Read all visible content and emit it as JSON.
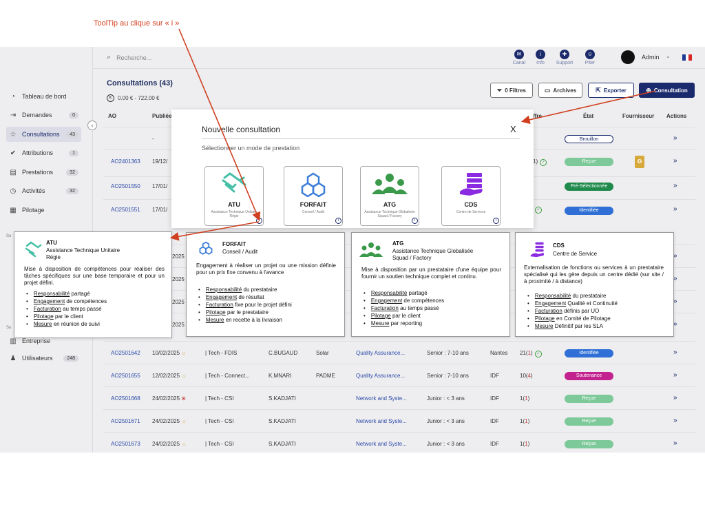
{
  "annotation": "ToolTip au clique sur « i »",
  "search": {
    "placeholder": "Recherche..."
  },
  "tools": [
    {
      "label": "Canal",
      "icon": "chat-icon"
    },
    {
      "label": "Info",
      "icon": "info-icon"
    },
    {
      "label": "Support",
      "icon": "lifebuoy-icon"
    },
    {
      "label": "Piter",
      "icon": "bot-icon"
    }
  ],
  "user": {
    "name": "Admin"
  },
  "flag_colors": [
    "#1f3a93",
    "#ffffff",
    "#d62828"
  ],
  "sidebar": {
    "items": [
      {
        "label": "Tableau de bord",
        "count": ""
      },
      {
        "label": "Demandes",
        "count": "0"
      },
      {
        "label": "Consultations",
        "count": "43"
      },
      {
        "label": "Attributions",
        "count": "1"
      },
      {
        "label": "Prestations",
        "count": "32"
      },
      {
        "label": "Activités",
        "count": "32"
      },
      {
        "label": "Pilotage",
        "count": ""
      }
    ],
    "section1": "So",
    "section2": "So",
    "lower_items": [
      {
        "label": "Entreprise",
        "count": ""
      },
      {
        "label": "Utilisateurs",
        "count": "248"
      }
    ]
  },
  "page": {
    "title": "Consultations (43)",
    "amount": "0.00 € - 722.00 €",
    "currency_symbol": "€"
  },
  "toolbar": {
    "filters": "0 Filtres",
    "archives": "Archives",
    "export": "Exporter",
    "new": "Consultation"
  },
  "table": {
    "headers": {
      "ao": "AO",
      "published": "Publiée",
      "offer": "ffre",
      "state": "État",
      "supplier": "Fournisseur",
      "actions": "Actions"
    },
    "top_rows": [
      {
        "ao": "",
        "date": "-",
        "offer": "",
        "state": "Brouillon"
      },
      {
        "ao": "AO2401363",
        "date": "19/12/",
        "offer": "1)",
        "state": "Reçue"
      },
      {
        "ao": "AO2501550",
        "date": "17/01/",
        "offer": "",
        "state": "Pré-Sélectionnée"
      },
      {
        "ao": "AO2501551",
        "date": "17/01/",
        "offer": "",
        "state": "Identifiée"
      }
    ],
    "hidden_row_dates": [
      "2025",
      "2025",
      "2025",
      "2025"
    ],
    "rows": [
      {
        "ao": "AO2501642",
        "date": "10/02/2025",
        "dept": "| Tech - FDIS",
        "buyer": "C.BUGAUD",
        "client": "Solar",
        "mission": "Quality Assurance...",
        "level": "Senior : 7-10 ans",
        "city": "Nantes",
        "offers": "21",
        "new": "1",
        "state": "Identifiée"
      },
      {
        "ao": "AO2501655",
        "date": "12/02/2025",
        "dept": "| Tech - Connect...",
        "buyer": "K.MNARI",
        "client": "PADME",
        "mission": "Quality Assurance...",
        "level": "Senior : 7-10 ans",
        "city": "IDF",
        "offers": "10",
        "new": "4",
        "state": "Soutenance"
      },
      {
        "ao": "AO2501668",
        "date": "24/02/2025",
        "dept": "| Tech - CSI",
        "buyer": "S.KADJATI",
        "client": "",
        "mission": "Network and Syste...",
        "level": "Junior : < 3 ans",
        "city": "IDF",
        "offers": "1",
        "new": "1",
        "state": "Reçue"
      },
      {
        "ao": "AO2501671",
        "date": "24/02/2025",
        "dept": "| Tech - CSI",
        "buyer": "S.KADJATI",
        "client": "",
        "mission": "Network and Syste...",
        "level": "Junior : < 3 ans",
        "city": "IDF",
        "offers": "1",
        "new": "1",
        "state": "Reçue"
      },
      {
        "ao": "AO2501673",
        "date": "24/02/2025",
        "dept": "| Tech - CSI",
        "buyer": "S.KADJATI",
        "client": "",
        "mission": "Network and Syste...",
        "level": "Junior : < 3 ans",
        "city": "IDF",
        "offers": "1",
        "new": "1",
        "state": "Reçue"
      }
    ],
    "state_colors": {
      "Brouillon": "#ffffff",
      "Reçue": "#7ec99a",
      "Pré-Sélectionnée": "#1f8a4c",
      "Identifiée": "#2f6fd6",
      "Soutenance": "#c2238f"
    }
  },
  "modal": {
    "title": "Nouvelle consultation",
    "close": "X",
    "subtitle": "Sélectionner un mode de prestation",
    "cards": [
      {
        "name": "ATU",
        "desc": "Assistance Technique Unitaire Régie",
        "info": "i"
      },
      {
        "name": "FORFAIT",
        "desc": "Conseil / Audit",
        "info": "i"
      },
      {
        "name": "ATG",
        "desc": "Assistance Technique Globalisée Squad / Factory",
        "info": "i"
      },
      {
        "name": "CDS",
        "desc": "Centre de Services",
        "info": "i"
      }
    ]
  },
  "tooltips": [
    {
      "name": "ATU",
      "sub1": "Assistance Technique Unitaire",
      "sub2": "Régie",
      "desc": "Mise à disposition de compétences pour réaliser des tâches spécifiques sur une base temporaire et pour un projet défini.",
      "items": [
        [
          "Responsabilité",
          " partagé"
        ],
        [
          "Engagement",
          " de compétences"
        ],
        [
          "Facturation",
          " au temps passé"
        ],
        [
          "Pilotage",
          " par le client"
        ],
        [
          "Mesure",
          " en réunion de suivi"
        ]
      ]
    },
    {
      "name": "FORFAIT",
      "sub1": "Conseil / Audit",
      "sub2": "",
      "desc": "Engagement à réaliser un projet ou une mission définie pour un prix fixe convenu à l'avance",
      "items": [
        [
          "Responsabilité",
          " du prestataire"
        ],
        [
          "Engagement",
          " de résultat"
        ],
        [
          "Facturation",
          " fixe pour le projet défini"
        ],
        [
          "Pilotage",
          " par le prestataire"
        ],
        [
          "Mesure",
          " en recette à la livraison"
        ]
      ]
    },
    {
      "name": "ATG",
      "sub1": "Assistance Technique Globalisée",
      "sub2": "Squad / Factory",
      "desc": "Mise à disposition par un prestataire d'une équipe pour fournir un soutien technique complet et continu.",
      "items": [
        [
          "Responsabilité",
          " partagé"
        ],
        [
          "Engagement",
          " de compétences"
        ],
        [
          "Facturation",
          " au temps passé"
        ],
        [
          "Pilotage",
          " par le client"
        ],
        [
          "Mesure",
          " par reporting"
        ]
      ]
    },
    {
      "name": "CDS",
      "sub1": "Centre de Service",
      "sub2": "",
      "desc": "Externalisation de fonctions ou services à un prestataire spécialisé qui les gère depuis un centre dédié (sur site / à proximité / à distance)",
      "items": [
        [
          "Responsabilité",
          " du prestataire"
        ],
        [
          "Engagement",
          " Qualité et Continuité"
        ],
        [
          "Facturation",
          " définis par UO"
        ],
        [
          "Pilotage",
          " en Comité de Pilotage"
        ],
        [
          "Mesure",
          " Définitif par les SLA"
        ]
      ]
    }
  ]
}
